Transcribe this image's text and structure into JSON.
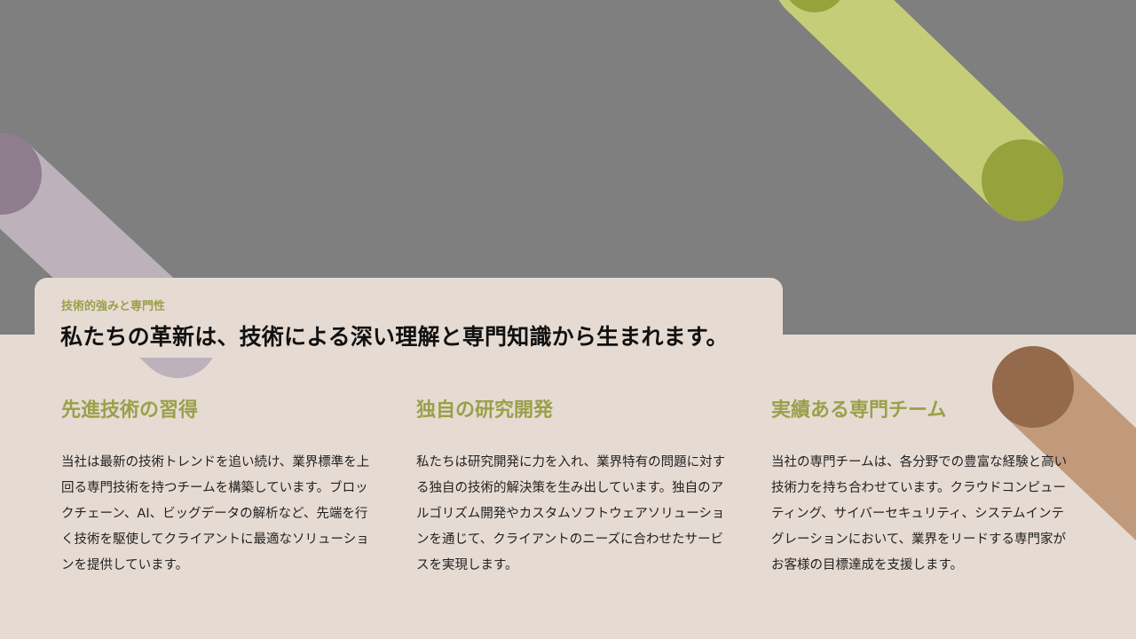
{
  "eyebrow": "技術的強みと専門性",
  "title": "私たちの革新は、技術による深い理解と専門知識から生まれます。",
  "columns": [
    {
      "heading": "先進技術の習得",
      "body": "当社は最新の技術トレンドを追い続け、業界標準を上回る専門技術を持つチームを構築しています。ブロックチェーン、AI、ビッグデータの解析など、先端を行く技術を駆使してクライアントに最適なソリューションを提供しています。"
    },
    {
      "heading": "独自の研究開発",
      "body": "私たちは研究開発に力を入れ、業界特有の問題に対する独自の技術的解決策を生み出しています。独自のアルゴリズム開発やカスタムソフトウェアソリューションを通じて、クライアントのニーズに合わせたサービスを実現します。"
    },
    {
      "heading": "実績ある専門チーム",
      "body": "当社の専門チームは、各分野での豊富な経験と高い技術力を持ち合わせています。クラウドコンピューティング、サイバーセキュリティ、システムインテグレーションにおいて、業界をリードする専門家がお客様の目標達成を支援します。"
    }
  ],
  "colors": {
    "top_band": "#7f7f7f",
    "bottom_band": "#e6dbd3",
    "accent_olive": "#9aa04a",
    "deco_green_light": "#c5cd78",
    "deco_green_dark": "#96a23c",
    "deco_mauve_light": "#bdb2bb",
    "deco_mauve_dark": "#8d7d8d",
    "deco_brown_light": "#c19a7c",
    "deco_brown_dark": "#94694c"
  }
}
